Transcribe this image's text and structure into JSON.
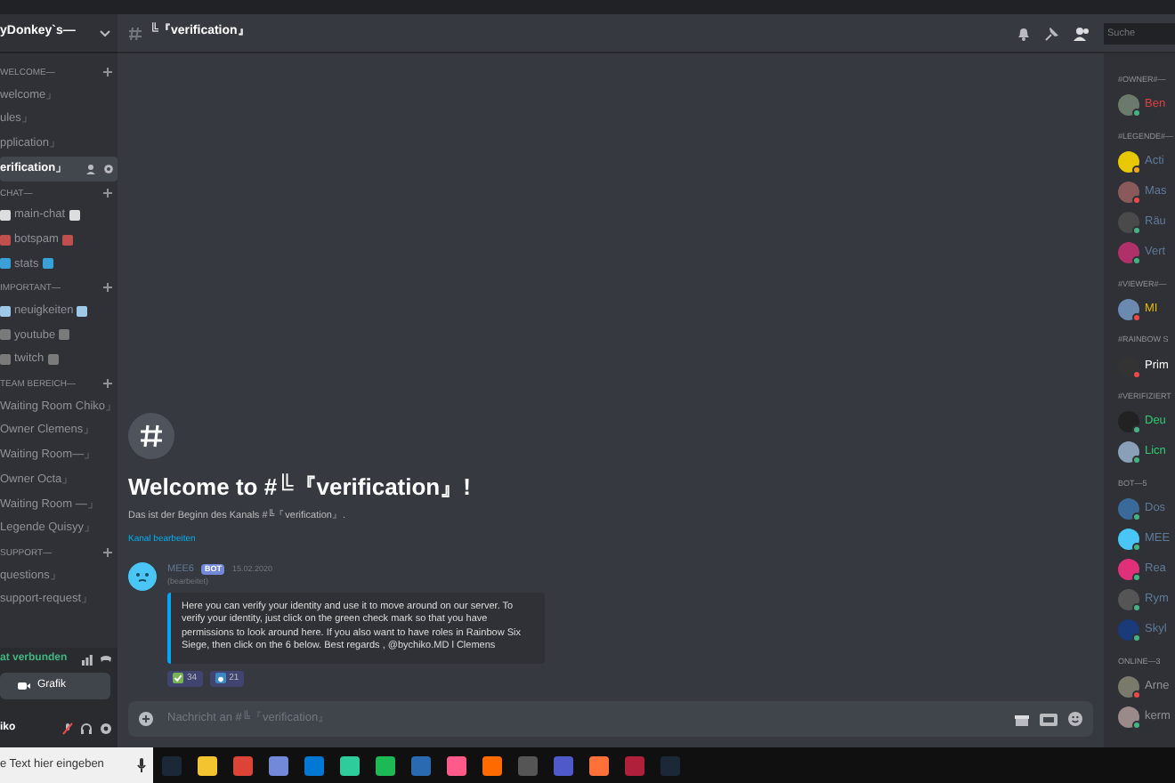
{
  "server": {
    "name": "yDonkey`s—"
  },
  "categories": [
    {
      "name": "WELCOME—",
      "channels": [
        {
          "name": "welcome」",
          "selected": false
        },
        {
          "name": "ules」",
          "selected": false
        },
        {
          "name": "pplication」",
          "selected": false
        },
        {
          "name": "erification」",
          "selected": true
        }
      ]
    },
    {
      "name": "CHAT—",
      "channels": [
        {
          "name": "main-chat",
          "selected": false
        },
        {
          "name": "botspam",
          "selected": false
        },
        {
          "name": "stats",
          "selected": false
        }
      ]
    },
    {
      "name": "IMPORTANT—",
      "channels": [
        {
          "name": "neuigkeiten",
          "selected": false
        },
        {
          "name": "youtube",
          "selected": false
        },
        {
          "name": "twitch",
          "selected": false
        }
      ]
    },
    {
      "name": "TEAM BEREICH—",
      "channels": [
        {
          "name": "Waiting Room Chiko」",
          "selected": false
        },
        {
          "name": "Owner Clemens」",
          "selected": false
        },
        {
          "name": "Waiting Room—」",
          "selected": false
        },
        {
          "name": "Owner Octa」",
          "selected": false
        },
        {
          "name": "Waiting Room —」",
          "selected": false
        },
        {
          "name": "Legende Quisyy」",
          "selected": false
        }
      ]
    },
    {
      "name": "SUPPORT—",
      "channels": [
        {
          "name": "questions」",
          "selected": false
        },
        {
          "name": "support-request」",
          "selected": false
        }
      ]
    }
  ],
  "voice": {
    "status": "at verbunden",
    "video_button": "Grafik"
  },
  "user": {
    "name": "iko"
  },
  "channel_header": {
    "title": "╚『verification』",
    "search_placeholder": "Suche"
  },
  "welcome": {
    "title": "Welcome to #╚『verification』!",
    "subtitle": "Das ist der Beginn des Kanals #╚『verification』.",
    "edit_link": "Kanal bearbeiten"
  },
  "message": {
    "author": "MEE6",
    "badge": "BOT",
    "date": "15.02.2020",
    "edited": "(bearbeitet)",
    "embed_text": "Here you can verify your identity and use it to move around on our server. To verify your identity, just click on the green check mark so that you have permissions to look around here. If you also want to have roles in Rainbow Six Siege, then click on the 6 below. Best regards , @bychiko.MD l Clemens",
    "reactions": [
      {
        "kind": "check",
        "count": "34"
      },
      {
        "kind": "six",
        "count": "21"
      }
    ]
  },
  "composer": {
    "placeholder": "Nachricht an #╚『verification』"
  },
  "member_groups": [
    {
      "name": "#OWNER#—",
      "members": [
        {
          "name": "Ben",
          "kind": "online",
          "color": "#e04040"
        }
      ]
    },
    {
      "name": "#LEGENDE#—",
      "members": [
        {
          "name": "Acti",
          "kind": "idle",
          "color": "#5f7a99"
        },
        {
          "name": "Mas",
          "kind": "dnd",
          "color": "#5f7a99"
        },
        {
          "name": "Räu",
          "kind": "online",
          "color": "#5f7a99"
        },
        {
          "name": "Vert",
          "kind": "online",
          "color": "#5f7a99"
        }
      ]
    },
    {
      "name": "#VIEWER#—",
      "members": [
        {
          "name": "MI",
          "kind": "dnd",
          "color": "#e8b900"
        }
      ]
    },
    {
      "name": "#RAINBOW S",
      "members": [
        {
          "name": "Prim",
          "kind": "dnd",
          "color": "#ffffff"
        }
      ]
    },
    {
      "name": "#VERIFIZIERT",
      "members": [
        {
          "name": "Deu",
          "kind": "online",
          "color": "#2ecc71"
        },
        {
          "name": "Licn",
          "kind": "online",
          "color": "#2ecc71"
        }
      ]
    },
    {
      "name": "BOT—5",
      "members": [
        {
          "name": "Dos",
          "kind": "online",
          "color": "#5f7a99"
        },
        {
          "name": "MEE",
          "kind": "online",
          "color": "#5f7a99"
        },
        {
          "name": "Rea",
          "kind": "online",
          "color": "#5f7a99"
        },
        {
          "name": "Rym",
          "kind": "online",
          "color": "#5f7a99"
        },
        {
          "name": "Skyl",
          "kind": "online",
          "color": "#5f7a99"
        }
      ]
    },
    {
      "name": "ONLINE—3",
      "members": [
        {
          "name": "Arne",
          "kind": "dnd",
          "color": "#8e9297"
        },
        {
          "name": "kerm",
          "kind": "online",
          "color": "#8e9297"
        }
      ]
    }
  ],
  "taskbar": {
    "search_text": "e Text hier eingeben"
  }
}
